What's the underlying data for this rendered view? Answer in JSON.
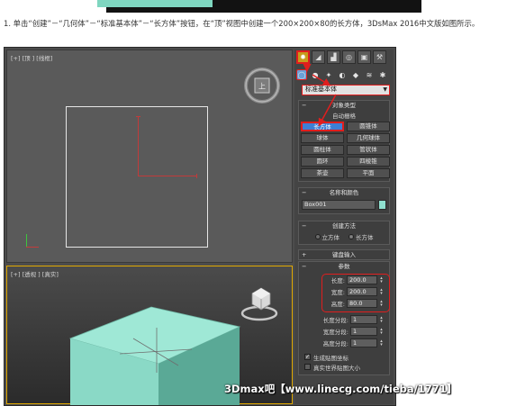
{
  "instruction": {
    "text": "1. 单击“创建”－“几何体”－“标准基本体”－“长方体”按钮，在“顶”视图中创建一个200×200×80的长方体，3DsMax 2016中文版如图所示。"
  },
  "viewports": {
    "top_label": "[+] [顶 ] [线框]",
    "perspective_label": "[+] [透视 ] [真实]",
    "viewcube_face": "上"
  },
  "command_panel": {
    "tabs": [
      {
        "icon": "create-icon",
        "active": true
      },
      {
        "icon": "modify-icon",
        "active": false
      },
      {
        "icon": "hierarchy-icon",
        "active": false
      },
      {
        "icon": "motion-icon",
        "active": false
      },
      {
        "icon": "display-icon",
        "active": false
      },
      {
        "icon": "utilities-icon",
        "active": false
      }
    ],
    "category_dropdown": "标准基本体",
    "object_type": {
      "title": "对象类型",
      "autogrid": "自动栅格",
      "buttons": [
        "长方体",
        "圆锥体",
        "球体",
        "几何球体",
        "圆柱体",
        "管状体",
        "圆环",
        "四棱锥",
        "茶壶",
        "平面"
      ],
      "active_button": "长方体"
    },
    "name_color": {
      "title": "名称和颜色",
      "name_value": "Box001",
      "swatch_color": "#8fe0cf"
    },
    "creation_method": {
      "title": "创建方法",
      "option_cube": "立方体",
      "option_box": "长方体",
      "selected": "长方体"
    },
    "keyboard_entry": {
      "title": "键盘输入"
    },
    "parameters": {
      "title": "参数",
      "length_label": "长度:",
      "length_value": "200.0",
      "width_label": "宽度:",
      "width_value": "200.0",
      "height_label": "高度:",
      "height_value": "80.0",
      "length_segs_label": "长度分段:",
      "length_segs_value": "1",
      "width_segs_label": "宽度分段:",
      "width_segs_value": "1",
      "height_segs_label": "高度分段:",
      "height_segs_value": "1",
      "gen_mapping_label": "生成贴图坐标",
      "gen_mapping_checked": true,
      "real_world_label": "真实世界贴图大小",
      "real_world_checked": false
    }
  },
  "watermark": "3Dmax吧【www.linecg.com/tieba/1771】",
  "colors": {
    "highlight_red": "#e01e1e",
    "box_teal": "#8fe0cf",
    "active_blue": "#3d7fd6",
    "viewport_bg": "#5a5a5a"
  }
}
